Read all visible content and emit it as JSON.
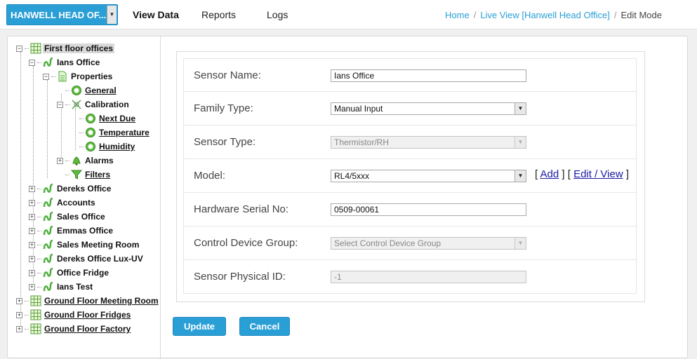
{
  "header": {
    "site_select": "HANWELL HEAD OF...",
    "tabs": [
      {
        "label": "View Data",
        "active": true
      },
      {
        "label": "Reports",
        "active": false
      },
      {
        "label": "Logs",
        "active": false
      }
    ],
    "breadcrumb": {
      "home": "Home",
      "live_view": "Live View [Hanwell Head Office]",
      "current": "Edit Mode"
    }
  },
  "tree": {
    "root": "First floor offices",
    "ians_office": "Ians Office",
    "properties": "Properties",
    "general": "General",
    "calibration": "Calibration",
    "next_due": "Next Due",
    "temperature": "Temperature",
    "humidity": "Humidity",
    "alarms": "Alarms",
    "filters": "Filters",
    "dereks_office": "Dereks Office",
    "accounts": "Accounts",
    "sales_office": "Sales Office",
    "emmas_office": "Emmas Office",
    "sales_meeting_room": "Sales Meeting Room",
    "dereks_office_lux_uv": "Dereks Office Lux-UV",
    "office_fridge": "Office Fridge",
    "ians_test": "Ians Test",
    "ground_floor_meeting_room": "Ground Floor Meeting Room",
    "ground_floor_fridges": "Ground Floor Fridges",
    "ground_floor_factory": "Ground Floor Factory"
  },
  "form": {
    "sensor_name": {
      "label": "Sensor Name:",
      "value": "Ians Office"
    },
    "family_type": {
      "label": "Family Type:",
      "value": "Manual Input"
    },
    "sensor_type": {
      "label": "Sensor Type:",
      "value": "Thermistor/RH"
    },
    "model": {
      "label": "Model:",
      "value": "RL4/5xxx",
      "add": "Add",
      "edit_view": "Edit / View",
      "open_bracket": "[",
      "mid_bracket": "] [",
      "close_bracket": "]"
    },
    "hardware_serial": {
      "label": "Hardware Serial No:",
      "value": "0509-00061"
    },
    "control_device_group": {
      "label": "Control Device Group:",
      "placeholder": "Select Control Device Group"
    },
    "sensor_physical_id": {
      "label": "Sensor Physical ID:",
      "value": "-1"
    }
  },
  "buttons": {
    "update": "Update",
    "cancel": "Cancel"
  },
  "colors": {
    "accent": "#2a9fd6",
    "link": "#1a1aa6",
    "tree_icon_green": "#4caf3c"
  }
}
